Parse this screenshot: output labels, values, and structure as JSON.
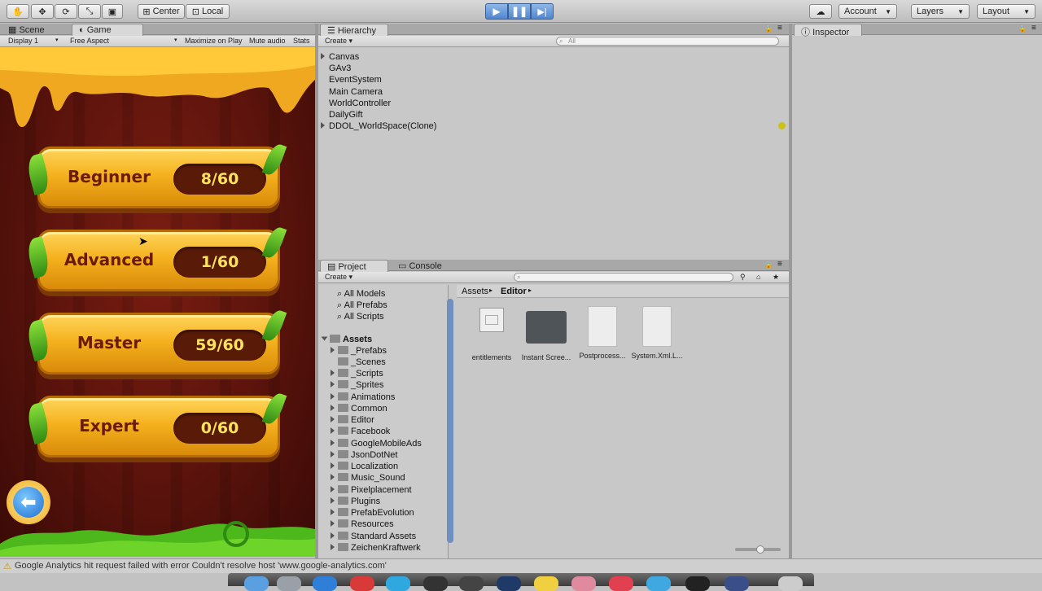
{
  "toolbar": {
    "pivot_center": "Center",
    "pivot_local": "Local",
    "account": "Account",
    "layers": "Layers",
    "layout": "Layout"
  },
  "scene_tabs": {
    "scene": "Scene",
    "game": "Game"
  },
  "game_bar": {
    "display": "Display 1",
    "aspect": "Free Aspect",
    "maximize": "Maximize on Play",
    "mute": "Mute audio",
    "stats": "Stats"
  },
  "game": {
    "levels": [
      {
        "name": "Beginner",
        "score": "8/60"
      },
      {
        "name": "Advanced",
        "score": "1/60"
      },
      {
        "name": "Master",
        "score": "59/60"
      },
      {
        "name": "Expert",
        "score": "0/60"
      }
    ]
  },
  "hierarchy": {
    "title": "Hierarchy",
    "create": "Create",
    "search_placeholder": "All",
    "items": [
      "Canvas",
      "GAv3",
      "EventSystem",
      "Main Camera",
      "WorldController",
      "DailyGift",
      "DDOL_WorldSpace(Clone)"
    ]
  },
  "inspector": {
    "title": "Inspector"
  },
  "project": {
    "title": "Project",
    "console": "Console",
    "create": "Create",
    "favorites": [
      "All Models",
      "All Prefabs",
      "All Scripts"
    ],
    "assets_root": "Assets",
    "folders": [
      "_Prefabs",
      "_Scenes",
      "_Scripts",
      "_Sprites",
      "Animations",
      "Common",
      "Editor",
      "Facebook",
      "GoogleMobileAds",
      "JsonDotNet",
      "Localization",
      "Music_Sound",
      "Pixelplacement",
      "Plugins",
      "PrefabEvolution",
      "Resources",
      "Standard Assets",
      "ZeichenKraftwerk"
    ],
    "breadcrumb": [
      "Assets",
      "Editor"
    ],
    "files": [
      "entitlements",
      "Instant Scree...",
      "Postprocess...",
      "System.Xml.L..."
    ]
  },
  "status": {
    "message": "Google Analytics hit request failed with error Couldn't resolve host 'www.google-analytics.com'"
  }
}
